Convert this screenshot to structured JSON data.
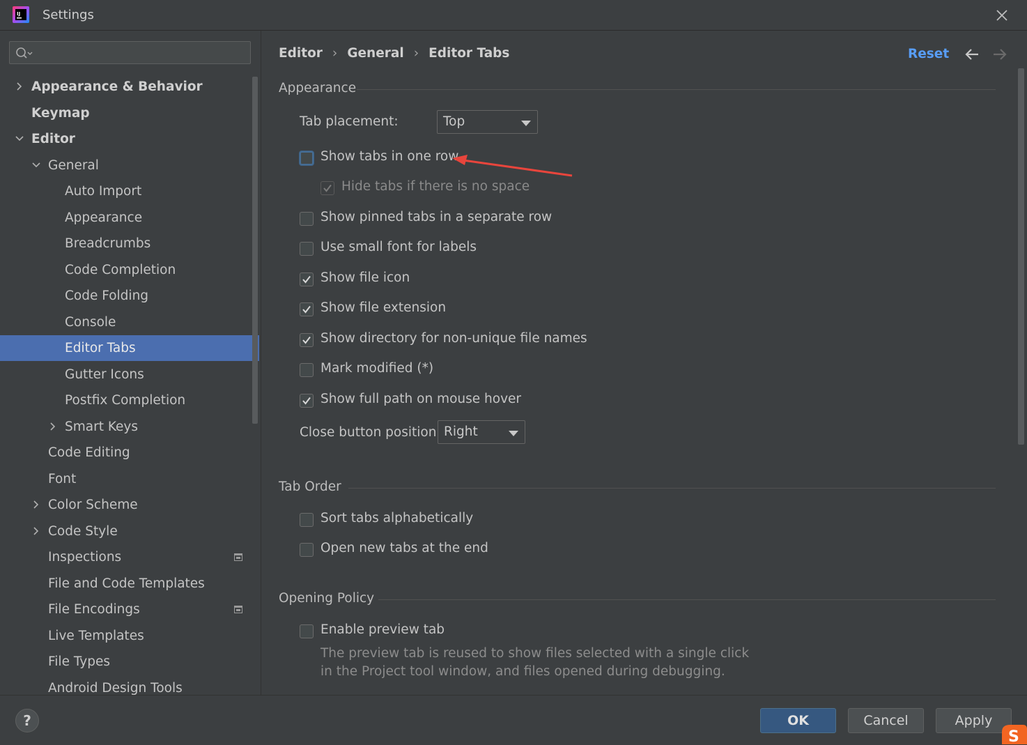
{
  "window": {
    "title": "Settings"
  },
  "sidebar": {
    "search_placeholder": "",
    "items": [
      {
        "label": "Appearance & Behavior",
        "level": 0,
        "bold": true,
        "expander": "collapsed"
      },
      {
        "label": "Keymap",
        "level": 0,
        "bold": true,
        "expander": "none"
      },
      {
        "label": "Editor",
        "level": 0,
        "bold": true,
        "expander": "expanded"
      },
      {
        "label": "General",
        "level": 1,
        "bold": false,
        "expander": "expanded"
      },
      {
        "label": "Auto Import",
        "level": 2,
        "bold": false,
        "expander": "none"
      },
      {
        "label": "Appearance",
        "level": 2,
        "bold": false,
        "expander": "none"
      },
      {
        "label": "Breadcrumbs",
        "level": 2,
        "bold": false,
        "expander": "none"
      },
      {
        "label": "Code Completion",
        "level": 2,
        "bold": false,
        "expander": "none"
      },
      {
        "label": "Code Folding",
        "level": 2,
        "bold": false,
        "expander": "none"
      },
      {
        "label": "Console",
        "level": 2,
        "bold": false,
        "expander": "none"
      },
      {
        "label": "Editor Tabs",
        "level": 2,
        "bold": false,
        "expander": "none",
        "selected": true
      },
      {
        "label": "Gutter Icons",
        "level": 2,
        "bold": false,
        "expander": "none"
      },
      {
        "label": "Postfix Completion",
        "level": 2,
        "bold": false,
        "expander": "none"
      },
      {
        "label": "Smart Keys",
        "level": 2,
        "bold": false,
        "expander": "collapsed"
      },
      {
        "label": "Code Editing",
        "level": 1,
        "bold": false,
        "expander": "none"
      },
      {
        "label": "Font",
        "level": 1,
        "bold": false,
        "expander": "none"
      },
      {
        "label": "Color Scheme",
        "level": 1,
        "bold": false,
        "expander": "collapsed"
      },
      {
        "label": "Code Style",
        "level": 1,
        "bold": false,
        "expander": "collapsed"
      },
      {
        "label": "Inspections",
        "level": 1,
        "bold": false,
        "expander": "none",
        "project_icon": true
      },
      {
        "label": "File and Code Templates",
        "level": 1,
        "bold": false,
        "expander": "none"
      },
      {
        "label": "File Encodings",
        "level": 1,
        "bold": false,
        "expander": "none",
        "project_icon": true
      },
      {
        "label": "Live Templates",
        "level": 1,
        "bold": false,
        "expander": "none"
      },
      {
        "label": "File Types",
        "level": 1,
        "bold": false,
        "expander": "none"
      },
      {
        "label": "Android Design Tools",
        "level": 1,
        "bold": false,
        "expander": "none"
      }
    ]
  },
  "breadcrumb": [
    "Editor",
    "General",
    "Editor Tabs"
  ],
  "header": {
    "reset_label": "Reset"
  },
  "appearance": {
    "title": "Appearance",
    "tab_placement_label": "Tab placement:",
    "tab_placement_value": "Top",
    "options": [
      {
        "label": "Show tabs in one row",
        "checked": false,
        "focused": true
      },
      {
        "label": "Hide tabs if there is no space",
        "checked": true,
        "disabled": true,
        "indent": true
      },
      {
        "label": "Show pinned tabs in a separate row",
        "checked": false
      },
      {
        "label": "Use small font for labels",
        "checked": false
      },
      {
        "label": "Show file icon",
        "checked": true
      },
      {
        "label": "Show file extension",
        "checked": true
      },
      {
        "label": "Show directory for non-unique file names",
        "checked": true
      },
      {
        "label": "Mark modified (*)",
        "checked": false
      },
      {
        "label": "Show full path on mouse hover",
        "checked": true
      }
    ],
    "close_button_label": "Close button position:",
    "close_button_value": "Right"
  },
  "tab_order": {
    "title": "Tab Order",
    "options": [
      {
        "label": "Sort tabs alphabetically",
        "checked": false
      },
      {
        "label": "Open new tabs at the end",
        "checked": false
      }
    ]
  },
  "opening_policy": {
    "title": "Opening Policy",
    "options": [
      {
        "label": "Enable preview tab",
        "checked": false
      }
    ],
    "description_line1": "The preview tab is reused to show files selected with a single click",
    "description_line2": "in the Project tool window, and files opened during debugging."
  },
  "footer": {
    "help_label": "?",
    "ok_label": "OK",
    "cancel_label": "Cancel",
    "apply_label": "Apply"
  },
  "colors": {
    "background": "#3c3f41",
    "selection": "#4b6eaf",
    "link": "#589df6",
    "primary_button": "#365880",
    "annotation_arrow": "#e8453c"
  },
  "icons": {
    "app": "intellij-idea-icon",
    "search": "search-icon",
    "close": "close-icon",
    "back": "arrow-left-icon",
    "forward": "arrow-right-icon",
    "project_scope": "project-scope-icon",
    "sogou": "sogou-ime-icon"
  }
}
